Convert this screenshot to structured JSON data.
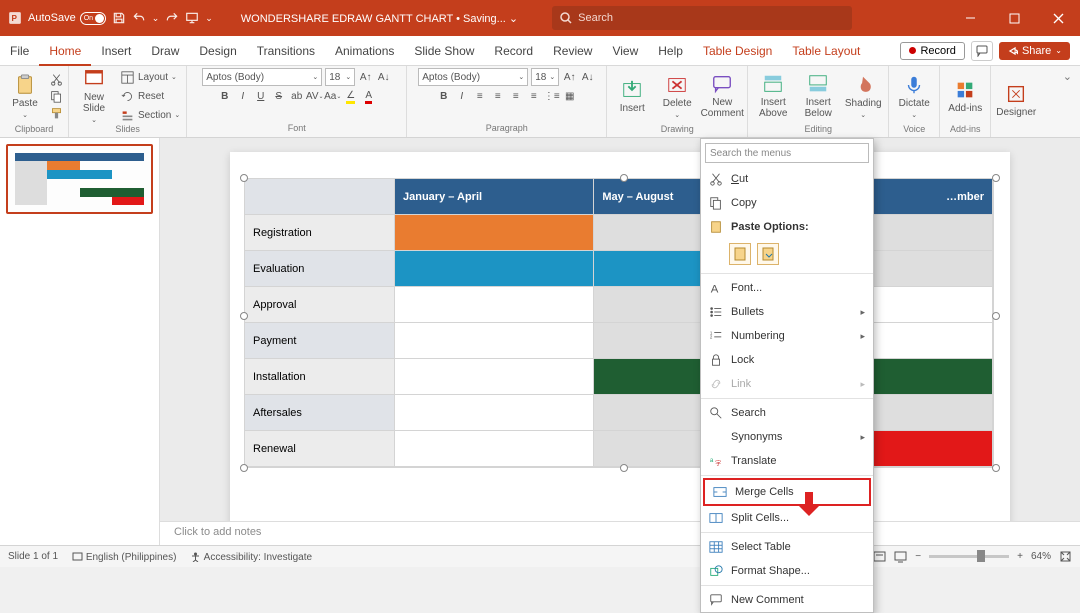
{
  "titlebar": {
    "autosave_label": "AutoSave",
    "autosave_state": "On",
    "doc_title": "WONDERSHARE EDRAW GANTT CHART • Saving... ⌄",
    "search_placeholder": "Search"
  },
  "tabs": {
    "file": "File",
    "home": "Home",
    "insert": "Insert",
    "draw": "Draw",
    "design": "Design",
    "transitions": "Transitions",
    "animations": "Animations",
    "slideshow": "Slide Show",
    "record": "Record",
    "review": "Review",
    "view": "View",
    "help": "Help",
    "tabledesign": "Table Design",
    "tablelayout": "Table Layout",
    "record_btn": "Record",
    "share": "Share"
  },
  "ribbon": {
    "clipboard": "Clipboard",
    "paste": "Paste",
    "slides": "Slides",
    "newslide": "New\nSlide",
    "layout": "Layout",
    "reset": "Reset",
    "section": "Section",
    "font_label": "Font",
    "font_name": "Aptos (Body)",
    "font_size": "18",
    "paragraph": "Paragraph",
    "insert_lbl": "Insert",
    "delete_lbl": "Delete",
    "newcomment": "New\nComment",
    "insertabove": "Insert\nAbove",
    "insertbelow": "Insert\nBelow",
    "shading": "Shading",
    "drawing": "Drawing",
    "editing": "Editing",
    "dictate": "Dictate",
    "voice": "Voice",
    "addins": "Add-ins",
    "designer": "Designer"
  },
  "chart_data": {
    "type": "table",
    "title": "Gantt Chart",
    "columns": [
      "",
      "January – April",
      "May – August",
      "September – December"
    ],
    "rows": [
      {
        "label": "Registration",
        "cells": [
          "orange",
          "gray",
          "gray"
        ]
      },
      {
        "label": "Evaluation",
        "cells": [
          "blue",
          "blue",
          "gray"
        ]
      },
      {
        "label": "Approval",
        "cells": [
          "",
          "gray",
          ""
        ]
      },
      {
        "label": "Payment",
        "cells": [
          "",
          "gray",
          ""
        ]
      },
      {
        "label": "Installation",
        "cells": [
          "",
          "green",
          "green"
        ]
      },
      {
        "label": "Aftersales",
        "cells": [
          "",
          "gray",
          "gray"
        ]
      },
      {
        "label": "Renewal",
        "cells": [
          "",
          "gray",
          "red"
        ]
      }
    ],
    "col3_truncated": "…mber"
  },
  "context_menu": {
    "search_placeholder": "Search the menus",
    "cut": "Cut",
    "copy": "Copy",
    "paste_options": "Paste Options:",
    "font": "Font...",
    "bullets": "Bullets",
    "numbering": "Numbering",
    "lock": "Lock",
    "link": "Link",
    "search": "Search",
    "synonyms": "Synonyms",
    "translate": "Translate",
    "merge": "Merge Cells",
    "split": "Split Cells...",
    "select_table": "Select Table",
    "format_shape": "Format Shape...",
    "new_comment": "New Comment"
  },
  "notes": {
    "placeholder": "Click to add notes"
  },
  "status": {
    "slide": "Slide 1 of 1",
    "lang": "English (Philippines)",
    "access": "Accessibility: Investigate",
    "zoom": "64%"
  },
  "thumb_num": "1"
}
